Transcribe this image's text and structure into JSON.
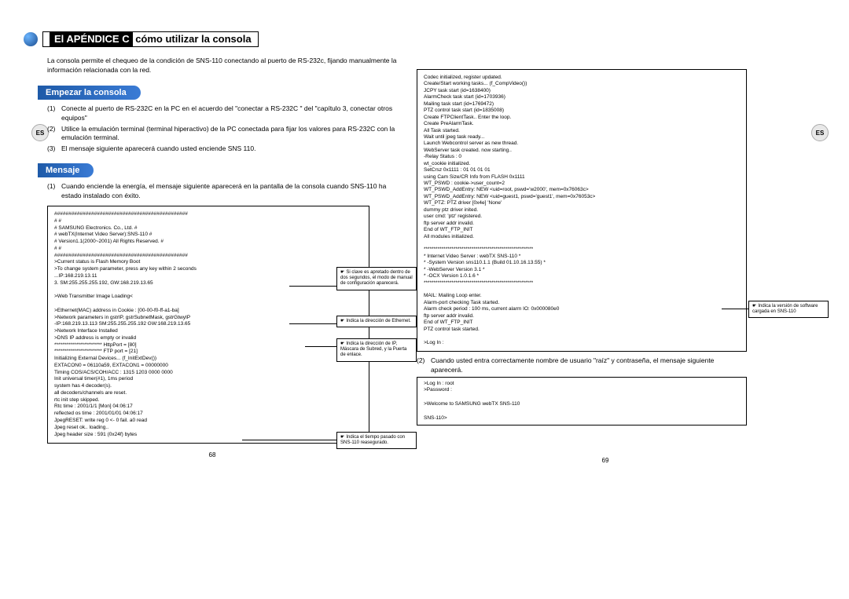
{
  "appendix_title_highlight": "El APÉNDICE C",
  "appendix_title_rest": " cómo utilizar la consola",
  "intro": "La consola permite el chequeo de la condición de SNS-110 conectando al puerto de RS-232c, fijando manualmente la información relacionada con la red.",
  "section1": "Empezar la consola",
  "step1_num": "(1)",
  "step1": "Conecte al puerto de RS-232C en la PC en el acuerdo del \"conectar a RS-232C \" del \"capítulo 3, conectar otros equipos\"",
  "step2_num": "(2)",
  "step2": "Utilice la emulación terminal (terminal hiperactivo) de la PC conectada para fijar los valores para RS-232C con la emulación terminal.",
  "step3_num": "(3)",
  "step3": "El mensaje siguiente aparecerá cuando usted enciende SNS 110.",
  "section2": "Mensaje",
  "mensaje_intro_num": "(1)",
  "mensaje_intro": "Cuando enciende la energía, el mensaje siguiente aparecerá en la pantalla de la consola cuando SNS-110 ha estado instalado con éxito.",
  "console_left": "###############################################\n#                                                                                                #\n#            SAMSUNG Electronics. Co., Ltd.                                          #\n#            webTX(Internet Video Server):SNS-110                              #\n#            Version1.1(2000~2001) All Rights Reserved.                        #\n#                                                                                                #\n###############################################\n>Current status is Flash Memory Boot\n>To change system parameter, press any key within 2 seconds\n   ...IP:168.219.13.11\n   3. SM:255.255.255.192, GW:168.219.13.65\n\n>Web Transmitter Image Loading<\n\n>Ethernet(MAC) address in Cookie : [00-00-f0-ff-a1-ba]\n>Network parameters in gstrIP, gstrSubnetMask, gstrGtwyIP\n  -IP:168.219.13.113 SM:255.255.255.192 GW:168.219.13.65\n>Network Interface Installed\n>DNS IP address is empty or invalid\n************************ HttpPort = [80]\n************************ FTP port = [21]\nInitializing External Devices... (f_InitExtDev())\nEXTACON0 = 06110a59, EXTACON1 = 00000000\nTiming COS/ACS/COH/ACC : 1315 1203 0000 0000\nInit universal timer(#1), 1ms period\nsystem has 4 decoder(s).\nall decoders/channels are reset.\nrtc init step skipped.\nRtc time : 2001/1/1 [Mon] 04:06:17\nreflected os time : 2001/01/01 04:06:17\nJpegRESET: write reg 0 <- 0 fail. a0 read\nJpeg reset ok.. loading..\nJpeg header size : 591 (0x24f) bytes",
  "console_right_top": "Codec initialized, register updated.\nCreate/Start working tasks... (f_CompVideo())\nJCPY task start (id=1638400)\nAlarmCheck task start (id=1703936)\nMailing task start (id=1769472)\nPTZ control task start (id=1835008)\nCreate FTPClientTask.. Enter the loop.\nCreate PreAlarmTask.\nAll Task started.\nWait until jpeg task ready...\nLaunch Webcontrol server as new thread.\nWebServer task created. now starting..\n-Relay Status : 0\nwt_cookie initialized.\nSetCrsz 0x1111 : 01 01 01 01\nusing Cam Size/CR Info from FLASH 0x1111\nWT_PSWD : cookie->user_count=2\nWT_PSWD_AddEntry: NEW <uid=root, pswd='w2000', mem=0x76063c>\nWT_PSWD_AddEntry: NEW <uid=guest1, pswd='guest1', mem=0x76053c>\nWT_PTZ: PTZ driver [0x4e] 'None'\ndummy ptz driver inited.\nuser cmd: 'ptz' registered.\nftp server addr invalid.\nEnd of WT_FTP_INIT\nAll modules initialized.\n\n*******************************************************\n*      Internet Video Server : webTX SNS-110                    *\n*      -System Version sns110.1.1 (Build 01.10.16.13.55)    *\n*      -WebServer Version 3.1                                              *\n*      -OCX Version 1.0.1.6                                                   *\n*******************************************************\n\nMAIL: Mailing Loop enter.\nAlarm-port checking Task started.\nAlarm check period : 100 ms, current alarm IO: 0x000080e0\nftp server addr invalid.\nEnd of WT_FTP_INIT\nPTZ control task started.\n\n>Log In :",
  "right_step2_num": "(2)",
  "right_step2": "Cuando usted entra correctamente nombre de usuario \"raíz\" y contraseña, el mensaje siguiente aparecerá.",
  "console_right_bottom": ">Log In : root\n>Password :\n\n>Welcome to SAMSUNG webTX SNS-110\n\nSNS-110>",
  "callout1": "Si clave es apretado dentro de dos segundos, el modo de manual de configuración aparecerá.",
  "callout2": "Indica la dirección de Ethernet.",
  "callout3": "Indica la dirección de IP, Máscara de Subred, y la Puerta de enlace.",
  "callout4": "Indica el tiempo pasado con SNS-110 reasegurado.",
  "callout5": "Indica la versión de software cargada en SNS-110",
  "page_left": "68",
  "page_right": "69",
  "es": "ES"
}
